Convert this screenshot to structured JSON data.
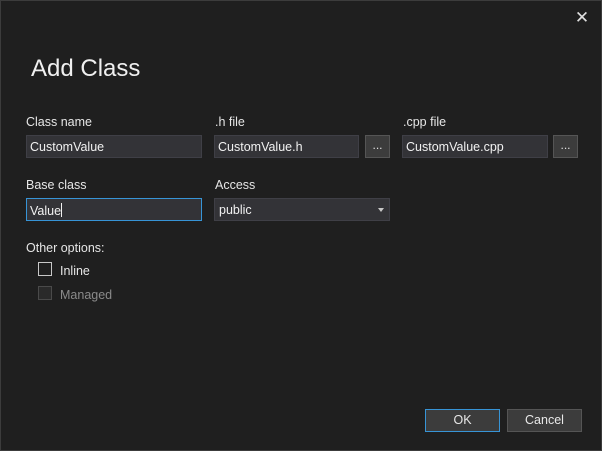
{
  "dialog": {
    "title": "Add Class",
    "close_glyph": "✕"
  },
  "fields": {
    "class_name": {
      "label": "Class name",
      "value": "CustomValue"
    },
    "h_file": {
      "label": ".h file",
      "value": "CustomValue.h",
      "browse": "..."
    },
    "cpp_file": {
      "label": ".cpp file",
      "value": "CustomValue.cpp",
      "browse": "..."
    },
    "base_class": {
      "label": "Base class",
      "value": "Value"
    },
    "access": {
      "label": "Access",
      "selected": "public"
    }
  },
  "options": {
    "label": "Other options:",
    "inline": {
      "label": "Inline",
      "checked": false,
      "enabled": true
    },
    "managed": {
      "label": "Managed",
      "checked": false,
      "enabled": false
    }
  },
  "buttons": {
    "ok": "OK",
    "cancel": "Cancel"
  },
  "colors": {
    "background": "#1f1f1f",
    "accent": "#3794d6",
    "input_bg": "#333337"
  }
}
